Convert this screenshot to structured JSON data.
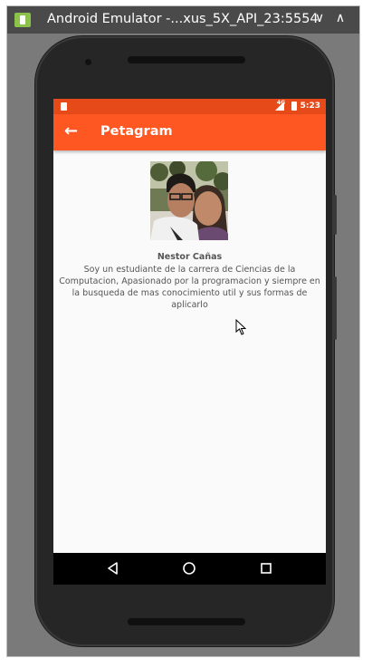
{
  "window": {
    "title": "Android Emulator -...xus_5X_API_23:5554",
    "minimize_glyph": "∨",
    "maximize_glyph": "∧"
  },
  "statusbar": {
    "network_label": "4G",
    "time": "5:23"
  },
  "appbar": {
    "back_glyph": "←",
    "title": "Petagram"
  },
  "profile": {
    "name": "Nestor Cañas",
    "bio": "Soy un estudiante de la carrera de Ciencias de la Computacion, Apasionado por la programacion y siempre en la busqueda de mas conocimiento util y sus formas de aplicarlo"
  },
  "navbar": {
    "icons": [
      "back-triangle-icon",
      "home-circle-icon",
      "recents-square-icon"
    ]
  },
  "colors": {
    "status_bar": "#e64a19",
    "app_bar": "#ff5722",
    "screen_background": "#fafafa",
    "phone_body": "#262626"
  }
}
